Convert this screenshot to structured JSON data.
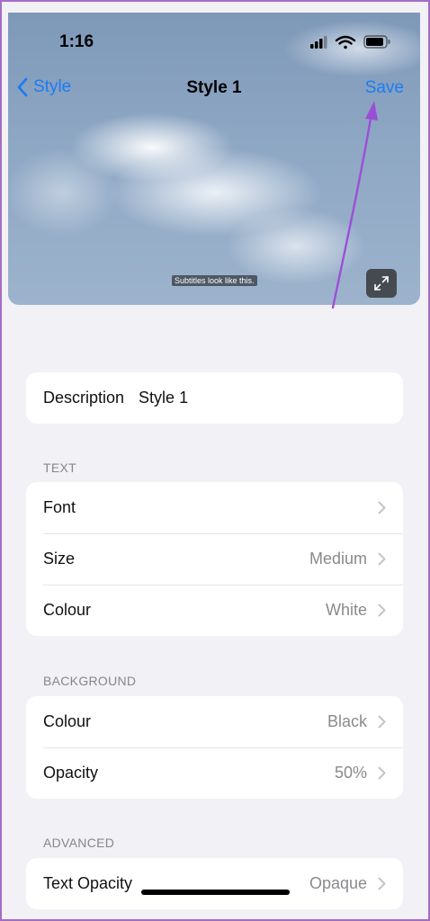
{
  "status_bar": {
    "time": "1:16",
    "icons": [
      "cellular-signal-icon",
      "wifi-icon",
      "battery-icon"
    ]
  },
  "nav": {
    "back_label": "Style",
    "title": "Style 1",
    "save_label": "Save"
  },
  "preview": {
    "subtitle_text": "Subtitles look like this."
  },
  "description": {
    "label": "Description",
    "value": "Style 1"
  },
  "text_section": {
    "header": "TEXT",
    "rows": [
      {
        "label": "Font",
        "value": ""
      },
      {
        "label": "Size",
        "value": "Medium"
      },
      {
        "label": "Colour",
        "value": "White"
      }
    ]
  },
  "background_section": {
    "header": "BACKGROUND",
    "rows": [
      {
        "label": "Colour",
        "value": "Black"
      },
      {
        "label": "Opacity",
        "value": "50%"
      }
    ]
  },
  "advanced_section": {
    "header": "ADVANCED",
    "rows": [
      {
        "label": "Text Opacity",
        "value": "Opaque"
      }
    ]
  },
  "colors": {
    "accent": "#1a7cf5",
    "annotation_arrow": "#9b4fd6",
    "frame_border": "#a56cc7"
  }
}
